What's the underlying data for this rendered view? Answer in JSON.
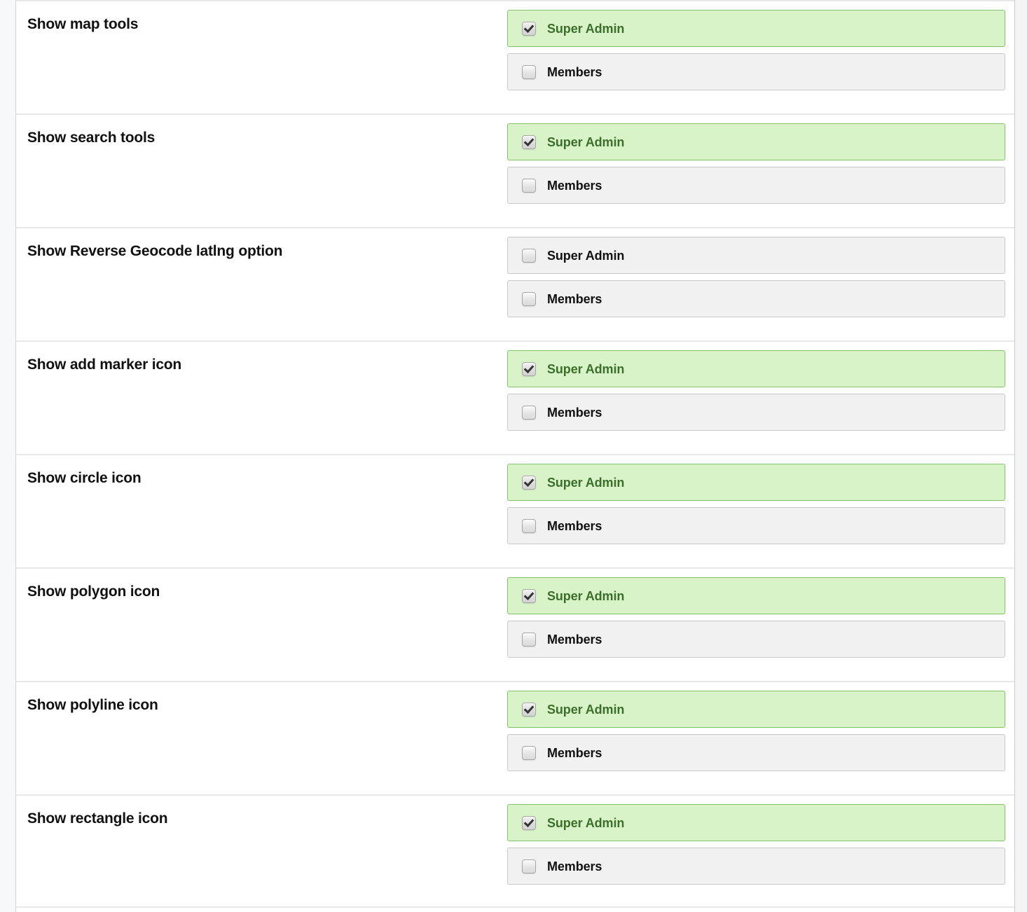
{
  "colors": {
    "checked_background": "#d8f3c7",
    "checked_border": "#82c46a",
    "checked_text": "#3c6e2c",
    "unchecked_background": "#f1f1f1",
    "unchecked_border": "#c9c9c9",
    "label_text": "#111111",
    "row_divider": "#e8e8e8",
    "page_chrome": "#f7f8f9"
  },
  "roles": {
    "super_admin": "Super Admin",
    "members": "Members"
  },
  "settings": [
    {
      "label": "Show map tools",
      "options": [
        {
          "role": "Super Admin",
          "checked": true
        },
        {
          "role": "Members",
          "checked": false
        }
      ]
    },
    {
      "label": "Show search tools",
      "options": [
        {
          "role": "Super Admin",
          "checked": true
        },
        {
          "role": "Members",
          "checked": false
        }
      ]
    },
    {
      "label": "Show Reverse Geocode latlng option",
      "options": [
        {
          "role": "Super Admin",
          "checked": false
        },
        {
          "role": "Members",
          "checked": false
        }
      ]
    },
    {
      "label": "Show add marker icon",
      "options": [
        {
          "role": "Super Admin",
          "checked": true
        },
        {
          "role": "Members",
          "checked": false
        }
      ]
    },
    {
      "label": "Show circle icon",
      "options": [
        {
          "role": "Super Admin",
          "checked": true
        },
        {
          "role": "Members",
          "checked": false
        }
      ]
    },
    {
      "label": "Show polygon icon",
      "options": [
        {
          "role": "Super Admin",
          "checked": true
        },
        {
          "role": "Members",
          "checked": false
        }
      ]
    },
    {
      "label": "Show polyline icon",
      "options": [
        {
          "role": "Super Admin",
          "checked": true
        },
        {
          "role": "Members",
          "checked": false
        }
      ]
    },
    {
      "label": "Show rectangle icon",
      "options": [
        {
          "role": "Super Admin",
          "checked": true
        },
        {
          "role": "Members",
          "checked": false
        }
      ]
    }
  ]
}
